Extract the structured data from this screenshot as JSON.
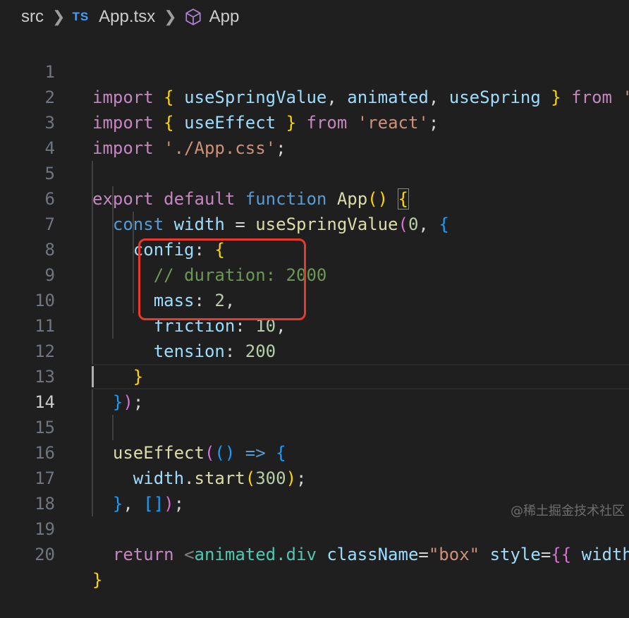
{
  "breadcrumb": {
    "folder": "src",
    "file_icon": "TS",
    "file": "App.tsx",
    "symbol": "App"
  },
  "line_numbers": [
    "1",
    "2",
    "3",
    "4",
    "5",
    "6",
    "7",
    "8",
    "9",
    "10",
    "11",
    "12",
    "13",
    "14",
    "15",
    "16",
    "17",
    "18",
    "19",
    "20"
  ],
  "code": {
    "l1": {
      "import": "import",
      "ob": "{",
      "a": "useSpringValue",
      "c1": ",",
      "b": "animated",
      "c2": ",",
      "d": "useSpring",
      "cb": "}",
      "from": "from",
      "str": "'"
    },
    "l2": {
      "import": "import",
      "ob": "{",
      "a": "useEffect",
      "cb": "}",
      "from": "from",
      "str": "'react'",
      "semi": ";"
    },
    "l3": {
      "import": "import",
      "str": "'./App.css'",
      "semi": ";"
    },
    "l5": {
      "export": "export",
      "default": "default",
      "function": "function",
      "name": "App",
      "paren": "()",
      "ob": "{"
    },
    "l6": {
      "const": "const",
      "var": "width",
      "eq": "=",
      "fn": "useSpringValue",
      "op": "(",
      "num": "0",
      "comma": ",",
      "ob": "{"
    },
    "l7": {
      "key": "config",
      "colon": ":",
      "ob": "{"
    },
    "l8": {
      "comment": "// duration: 2000"
    },
    "l9": {
      "key": "mass",
      "colon": ":",
      "num": "2",
      "comma": ","
    },
    "l10": {
      "key": "friction",
      "colon": ":",
      "num": "10",
      "comma": ","
    },
    "l11": {
      "key": "tension",
      "colon": ":",
      "num": "200"
    },
    "l12": {
      "cb": "}"
    },
    "l13": {
      "cb": "}",
      "cp": ")",
      "semi": ";"
    },
    "l15": {
      "fn": "useEffect",
      "op": "(",
      "args": "()",
      "arrow": "=>",
      "ob": "{"
    },
    "l16": {
      "var": "width",
      "dot": ".",
      "fn": "start",
      "op": "(",
      "num": "300",
      "cp": ")",
      "semi": ";"
    },
    "l17": {
      "cb": "}",
      "comma": ",",
      "arr": "[]",
      "cp": ")",
      "semi": ";"
    },
    "l19": {
      "return": "return",
      "lt": "<",
      "tag": "animated.div",
      "attr": "className",
      "eq": "=",
      "str": "\"box\"",
      "attr2": "style",
      "eq2": "=",
      "ob": "{{",
      "prop": "width"
    },
    "l20": {
      "cb": "}"
    }
  },
  "watermark": "@稀土掘金技术社区",
  "colors": {
    "background": "#1f1f1f",
    "highlight": "#e8392d"
  }
}
